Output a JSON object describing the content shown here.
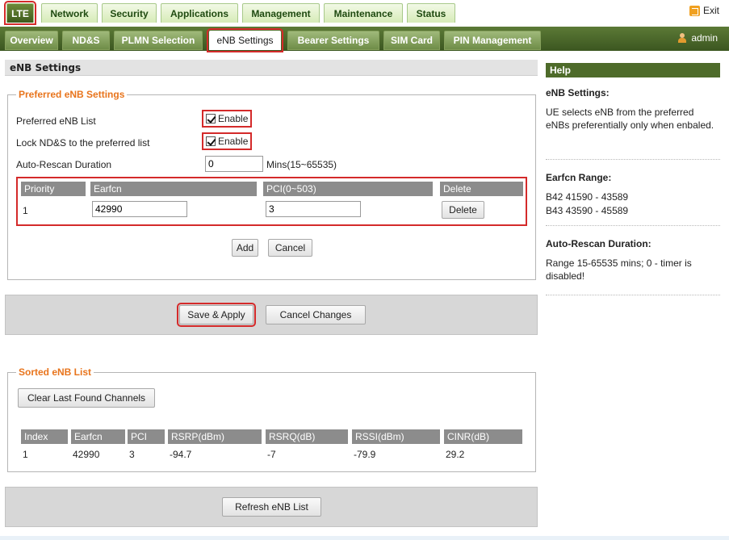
{
  "top_tabs": [
    {
      "label": "LTE",
      "active": true
    },
    {
      "label": "Network"
    },
    {
      "label": "Security"
    },
    {
      "label": "Applications"
    },
    {
      "label": "Management"
    },
    {
      "label": "Maintenance"
    },
    {
      "label": "Status"
    }
  ],
  "exit_label": "Exit",
  "sub_tabs": [
    {
      "label": "Overview"
    },
    {
      "label": "ND&S"
    },
    {
      "label": "PLMN Selection"
    },
    {
      "label": "eNB Settings",
      "active": true
    },
    {
      "label": "Bearer Settings"
    },
    {
      "label": "SIM Card"
    },
    {
      "label": "PIN Management"
    }
  ],
  "admin_label": "admin",
  "section_title": "eNB Settings",
  "preferred": {
    "legend": "Preferred eNB Settings",
    "list_label": "Preferred eNB List",
    "list_enable": "Enable",
    "lock_label": "Lock ND&S to the preferred list",
    "lock_enable": "Enable",
    "rescan_label": "Auto-Rescan Duration",
    "rescan_value": "0",
    "rescan_unit": "Mins(15~65535)",
    "table_headers": [
      "Priority",
      "Earfcn",
      "PCI(0~503)",
      "Delete"
    ],
    "table_row": {
      "priority": "1",
      "earfcn": "42990",
      "pci": "3",
      "delete": "Delete"
    },
    "add": "Add",
    "cancel": "Cancel"
  },
  "actions": {
    "save": "Save & Apply",
    "cancel_changes": "Cancel Changes"
  },
  "sorted": {
    "legend": "Sorted eNB List",
    "clear": "Clear Last Found Channels",
    "headers": [
      "Index",
      "Earfcn",
      "PCI",
      "RSRP(dBm)",
      "RSRQ(dB)",
      "RSSI(dBm)",
      "CINR(dB)"
    ],
    "row": [
      "1",
      "42990",
      "3",
      "-94.7",
      "-7",
      "-79.9",
      "29.2"
    ]
  },
  "refresh": "Refresh eNB List",
  "help": {
    "title": "Help",
    "s1_title": "eNB Settings:",
    "s1_text": "UE selects eNB from the preferred eNBs preferentially only when enbaled.",
    "s2_title": "Earfcn Range:",
    "s2_line1": "B42 41590 - 43589",
    "s2_line2": "B43 43590 - 45589",
    "s3_title": "Auto-Rescan Duration:",
    "s3_text": "Range 15-65535 mins; 0 - timer is disabled!"
  },
  "colors": {
    "accent_green": "#4e6b2a",
    "legend_orange": "#e8741c",
    "highlight_red": "#d42a2a"
  }
}
